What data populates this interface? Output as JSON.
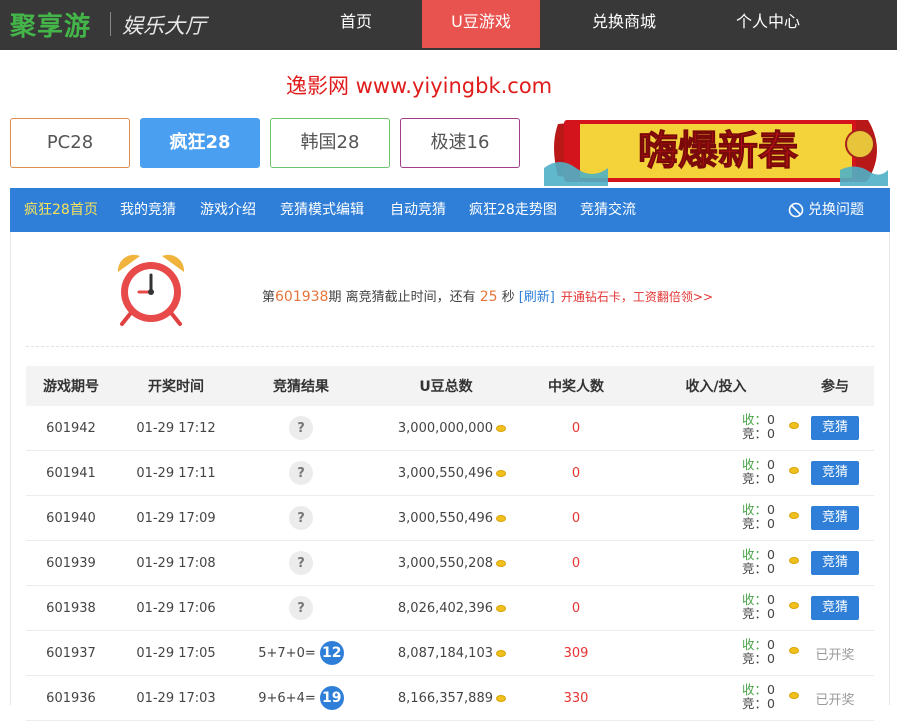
{
  "header": {
    "logo": "聚享游",
    "subtitle": "娱乐大厅",
    "nav": [
      {
        "label": "首页"
      },
      {
        "label": "U豆游戏"
      },
      {
        "label": "兑换商城"
      },
      {
        "label": "个人中心"
      }
    ]
  },
  "watermark": "逸影网 www.yiyingbk.com",
  "game_tabs": [
    {
      "label": "PC28"
    },
    {
      "label": "疯狂28"
    },
    {
      "label": "韩国28"
    },
    {
      "label": "极速16"
    }
  ],
  "banner": {
    "text": "嗨爆新春"
  },
  "subnav": {
    "items": [
      {
        "label": "疯狂28首页"
      },
      {
        "label": "我的竞猜"
      },
      {
        "label": "游戏介绍"
      },
      {
        "label": "竞猜模式编辑"
      },
      {
        "label": "自动竞猜"
      },
      {
        "label": "疯狂28走势图"
      },
      {
        "label": "竞猜交流"
      }
    ],
    "help": "兑换问题"
  },
  "countdown": {
    "prefix": "第",
    "period": "601938",
    "mid": "期 离竞猜截止时间，还有",
    "seconds": "25",
    "suffix": "秒",
    "refresh": "[刷新]",
    "promo": "开通钻石卡，工资翻倍领>>"
  },
  "table": {
    "headers": [
      "游戏期号",
      "开奖时间",
      "竞猜结果",
      "U豆总数",
      "中奖人数",
      "收入/投入",
      "参与"
    ],
    "income_label": "收：",
    "bet_label": "竞：",
    "bet_button": "竞猜",
    "opened_label": "已开奖",
    "unknown_mark": "?",
    "rows": [
      {
        "id": "601942",
        "time": "01-29 17:12",
        "result": "?",
        "total": "3,000,000,000",
        "winners": "0",
        "income": "0",
        "bet": "0",
        "action": "竞猜"
      },
      {
        "id": "601941",
        "time": "01-29 17:11",
        "result": "?",
        "total": "3,000,550,496",
        "winners": "0",
        "income": "0",
        "bet": "0",
        "action": "竞猜"
      },
      {
        "id": "601940",
        "time": "01-29 17:09",
        "result": "?",
        "total": "3,000,550,496",
        "winners": "0",
        "income": "0",
        "bet": "0",
        "action": "竞猜"
      },
      {
        "id": "601939",
        "time": "01-29 17:08",
        "result": "?",
        "total": "3,000,550,208",
        "winners": "0",
        "income": "0",
        "bet": "0",
        "action": "竞猜"
      },
      {
        "id": "601938",
        "time": "01-29 17:06",
        "result": "?",
        "total": "8,026,402,396",
        "winners": "0",
        "income": "0",
        "bet": "0",
        "action": "竞猜"
      },
      {
        "id": "601937",
        "time": "01-29 17:05",
        "result": "5+7+0=",
        "sum": "12",
        "total": "8,087,184,103",
        "winners": "309",
        "income": "0",
        "bet": "0",
        "action": "已开奖"
      },
      {
        "id": "601936",
        "time": "01-29 17:03",
        "result": "9+6+4=",
        "sum": "19",
        "total": "8,166,357,889",
        "winners": "330",
        "income": "0",
        "bet": "0",
        "action": "已开奖"
      }
    ]
  },
  "colors": {
    "topbar": "#383838",
    "active_nav": "#e9534f",
    "subnav": "#2f7fd8",
    "accent_yellow": "#f6e25a",
    "red": "#e53333",
    "logo_green": "#44b549"
  }
}
